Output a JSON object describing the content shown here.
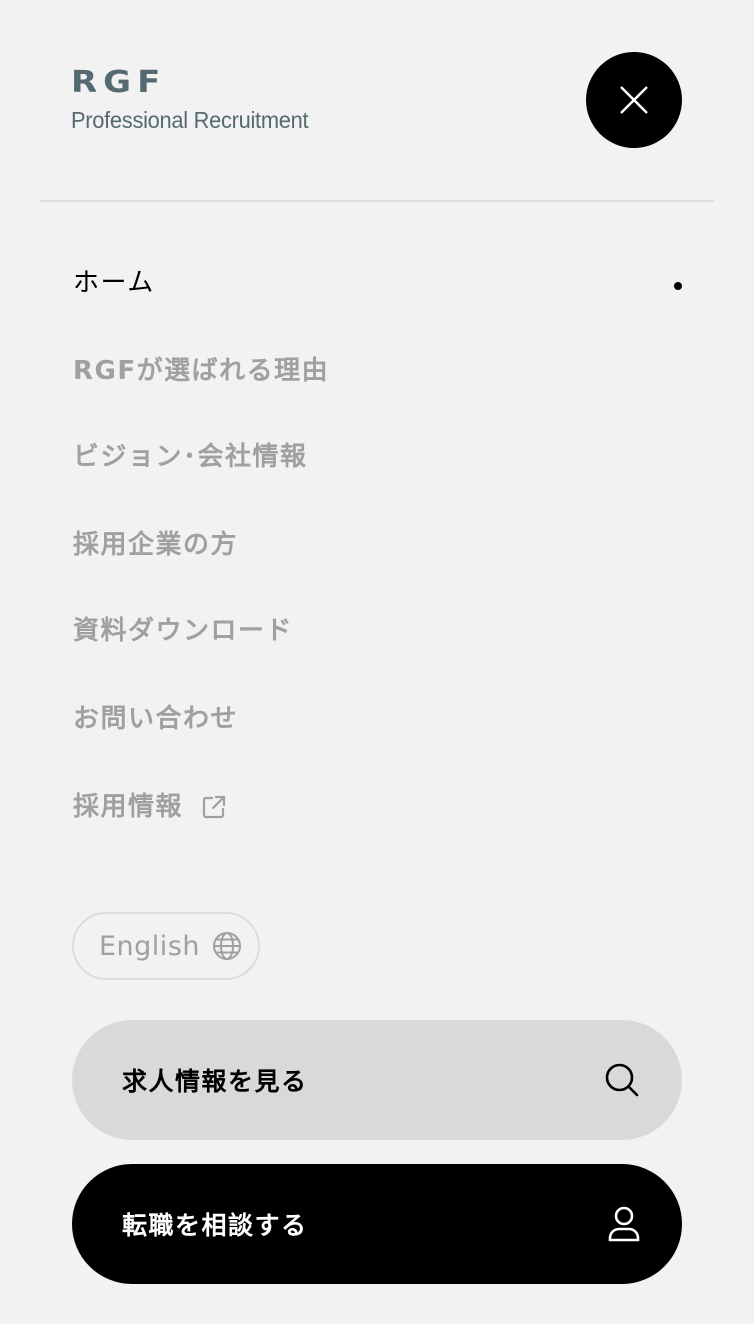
{
  "brand": {
    "mark": "RGF",
    "subtitle": "Professional Recruitment",
    "color": "#556a70"
  },
  "close_button": {
    "icon": "close-icon"
  },
  "nav": {
    "items": [
      {
        "label": "ホーム",
        "active": true
      },
      {
        "label": "RGFが選ばれる理由",
        "active": false
      },
      {
        "label": "ビジョン･会社情報",
        "active": false
      },
      {
        "label": "採用企業の方",
        "active": false
      },
      {
        "label": "資料ダウンロード",
        "active": false
      },
      {
        "label": "お問い合わせ",
        "active": false
      },
      {
        "label": "採用情報",
        "active": false,
        "icon": "external-link-icon"
      }
    ]
  },
  "language": {
    "label": "English",
    "icon": "globe-icon"
  },
  "actions": {
    "search_jobs": {
      "label": "求人情報を見る",
      "icon": "search-icon"
    },
    "consult": {
      "label": "転職を相談する",
      "icon": "user-icon"
    }
  },
  "colors": {
    "background": "#f2f2f2",
    "inactive_text": "#a0a0a0",
    "active_text": "#000000",
    "search_button_bg": "#d9d9d9",
    "consult_button_bg": "#000000"
  }
}
